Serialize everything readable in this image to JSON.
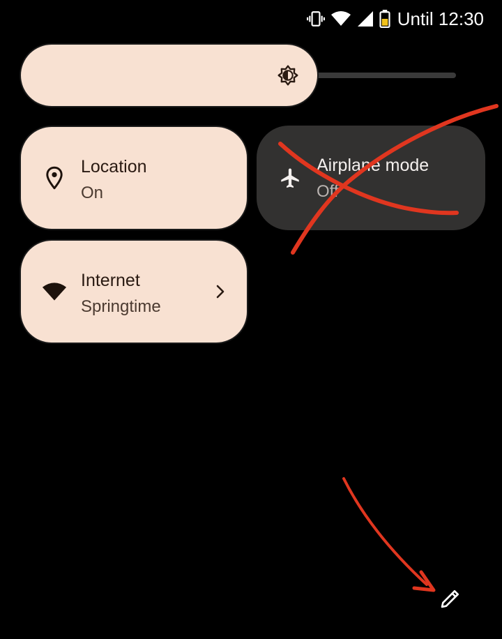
{
  "status_bar": {
    "text": "Until 12:30",
    "icons": [
      "vibrate-icon",
      "wifi-icon",
      "cell-signal-icon",
      "battery-saver-icon"
    ]
  },
  "brightness": {
    "level": 0.67,
    "icon": "brightness-icon"
  },
  "tiles": [
    {
      "title": "Location",
      "subtitle": "On",
      "icon": "location-pin-icon",
      "state": "on"
    },
    {
      "title": "Airplane mode",
      "subtitle": "Off",
      "icon": "airplane-icon",
      "state": "off"
    },
    {
      "title": "Internet",
      "subtitle": "Springtime",
      "icon": "wifi-icon",
      "state": "on",
      "has_chevron": true
    }
  ],
  "footer": {
    "edit_icon": "pencil-icon"
  },
  "colors": {
    "background": "#000000",
    "tile_on": "#f8e1d2",
    "tile_off": "#323130",
    "annotation_red": "#e0361f"
  }
}
